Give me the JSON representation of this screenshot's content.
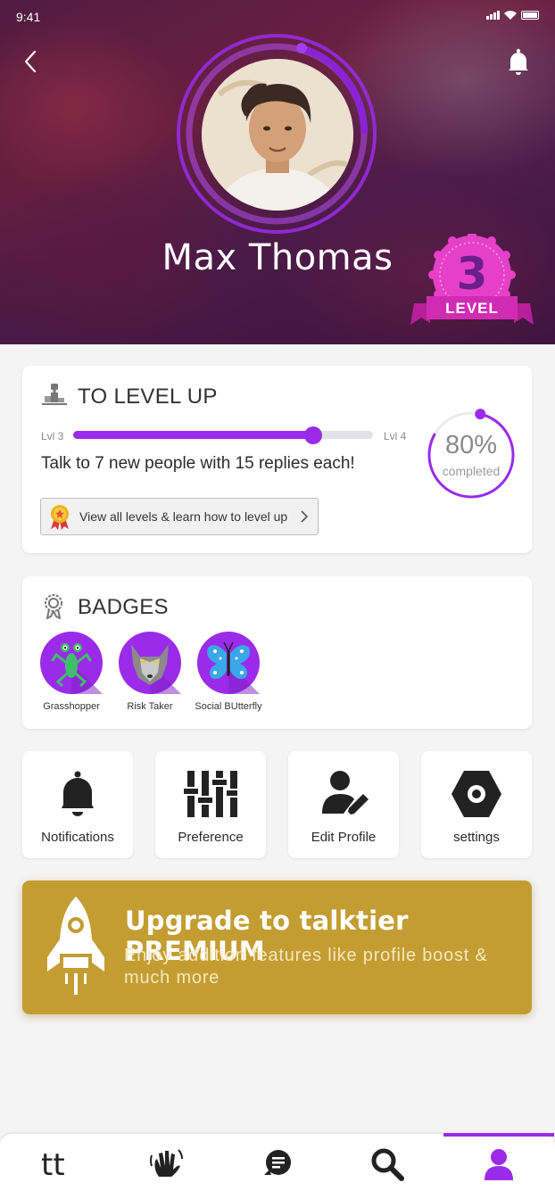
{
  "status_bar": {
    "time": "9:41"
  },
  "profile": {
    "name": "Max Thomas",
    "level_number": "3",
    "level_label": "LEVEL"
  },
  "level_up": {
    "title": "TO LEVEL UP",
    "from_level": "Lvl 3",
    "to_level": "Lvl 4",
    "progress_fraction": 0.8,
    "task": "Talk to 7 new people with 15 replies each!",
    "percent": "80%",
    "percent_label": "completed",
    "button_label": "View all levels & learn how to level up"
  },
  "badges": {
    "title": "BADGES",
    "items": [
      {
        "label": "Grasshopper",
        "icon": "grasshopper-icon"
      },
      {
        "label": "Risk Taker",
        "icon": "wolf-icon"
      },
      {
        "label": "Social BUtterfly",
        "icon": "butterfly-icon"
      }
    ]
  },
  "quick_actions": [
    {
      "label": "Notifications",
      "icon": "bell-icon"
    },
    {
      "label": "Preference",
      "icon": "sliders-icon"
    },
    {
      "label": "Edit Profile",
      "icon": "edit-profile-icon"
    },
    {
      "label": "settings",
      "icon": "hex-settings-icon"
    }
  ],
  "premium": {
    "title": "Upgrade to talktier PREMIUM",
    "subtitle": "Enjoy addition features like profile boost & much more"
  },
  "tabbar": {
    "items": [
      "home-logo-icon",
      "wave-hand-icon",
      "chat-icon",
      "search-icon",
      "profile-icon"
    ],
    "active": "profile-icon",
    "logo_text": "tt"
  },
  "colors": {
    "accent": "#9b2bea",
    "level_badge": "#e640c8",
    "premium": "#c39d32",
    "badge_circle": "#9b2bea"
  }
}
